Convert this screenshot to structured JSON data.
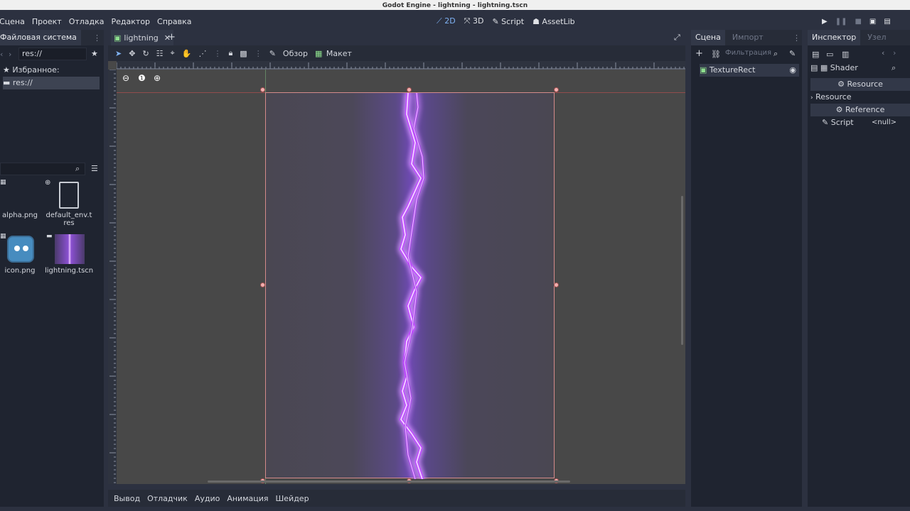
{
  "window": {
    "title": "Godot Engine - lightning - lightning.tscn"
  },
  "menu": [
    "Сцена",
    "Проект",
    "Отладка",
    "Редактор",
    "Справка"
  ],
  "workspaces": [
    {
      "label": "2D",
      "icon": "2d-icon",
      "active": true
    },
    {
      "label": "3D",
      "icon": "3d-icon",
      "active": false
    },
    {
      "label": "Script",
      "icon": "script-icon",
      "active": false
    },
    {
      "label": "AssetLib",
      "icon": "assetlib-icon",
      "active": false
    }
  ],
  "filesystem": {
    "tab_label": "Файловая система",
    "path": "res://",
    "favorites_label": "Избранное:",
    "root_item": "res://",
    "files": [
      {
        "name": "alpha.png",
        "icon": "image-icon"
      },
      {
        "name": "default_env.tres",
        "icon": "resource-file-icon"
      },
      {
        "name": "icon.png",
        "icon": "godot-logo-icon"
      },
      {
        "name": "lightning.tscn",
        "icon": "scene-thumbnail-icon"
      }
    ]
  },
  "editor": {
    "scene_tab": "lightning",
    "toolbar_view": "Обзор",
    "toolbar_layout": "Макет"
  },
  "scene_panel": {
    "tab_scene": "Сцена",
    "tab_import": "Импорт",
    "filter_placeholder": "Фильтрация",
    "node": "TextureRect"
  },
  "inspector": {
    "tab_inspector": "Инспектор",
    "tab_node": "Узел",
    "object": "Shader",
    "group_resource": "Resource",
    "row_resource": "Resource",
    "group_reference": "Reference",
    "script_label": "Script",
    "script_value": "<null>"
  },
  "bottom_tabs": [
    "Вывод",
    "Отладчик",
    "Аудио",
    "Анимация",
    "Шейдер"
  ],
  "colors": {
    "accent": "#7fb2f5",
    "selection": "#d48a8a",
    "bolt": "#c060ff"
  }
}
